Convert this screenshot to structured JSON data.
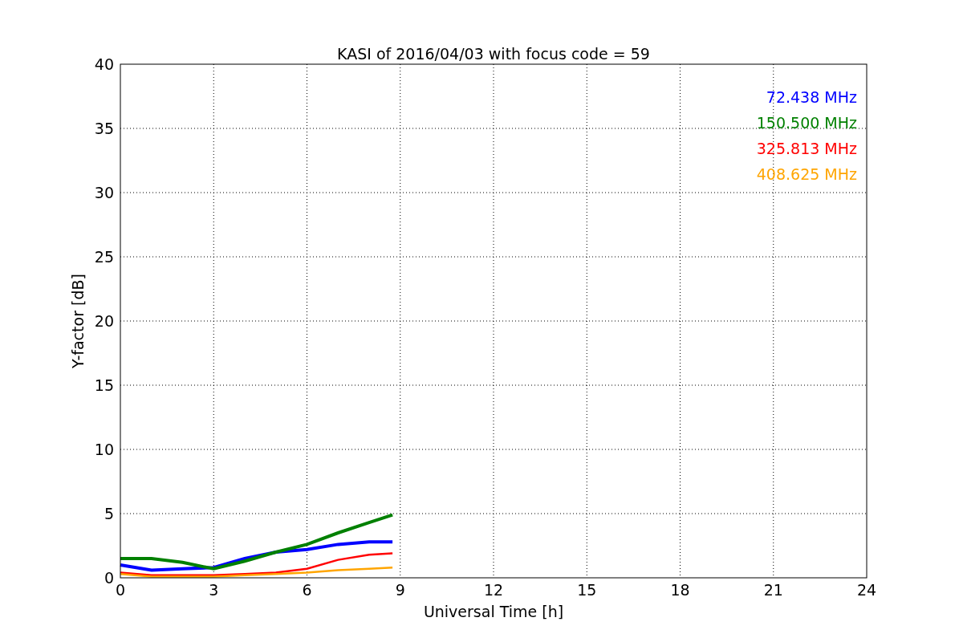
{
  "chart": {
    "chart_data": {
      "type": "line",
      "title": "KASI of 2016/04/03 with focus code = 59",
      "xlabel": "Universal Time [h]",
      "ylabel": "Y-factor [dB]",
      "x": [
        0,
        1,
        2,
        3,
        4,
        5,
        6,
        7,
        8,
        8.75
      ],
      "series": [
        {
          "name": "72.438 MHz",
          "color": "#0000ff",
          "values": [
            1.0,
            0.6,
            0.7,
            0.8,
            1.5,
            2.0,
            2.2,
            2.6,
            2.8,
            2.8
          ]
        },
        {
          "name": "150.500 MHz",
          "color": "#008000",
          "values": [
            1.5,
            1.5,
            1.2,
            0.7,
            1.3,
            2.0,
            2.6,
            3.5,
            4.3,
            4.9
          ]
        },
        {
          "name": "325.813 MHz",
          "color": "#ff0000",
          "values": [
            0.4,
            0.2,
            0.2,
            0.2,
            0.3,
            0.4,
            0.7,
            1.4,
            1.8,
            1.9
          ]
        },
        {
          "name": "408.625 MHz",
          "color": "#ffa500",
          "values": [
            0.3,
            0.1,
            0.1,
            0.1,
            0.2,
            0.3,
            0.4,
            0.6,
            0.7,
            0.8
          ]
        }
      ],
      "grid": true,
      "xlim": [
        0,
        24
      ],
      "ylim": [
        0,
        40
      ],
      "xticks": [
        0,
        3,
        6,
        9,
        12,
        15,
        18,
        21,
        24
      ],
      "yticks": [
        0,
        5,
        10,
        15,
        20,
        25,
        30,
        35,
        40
      ]
    }
  }
}
